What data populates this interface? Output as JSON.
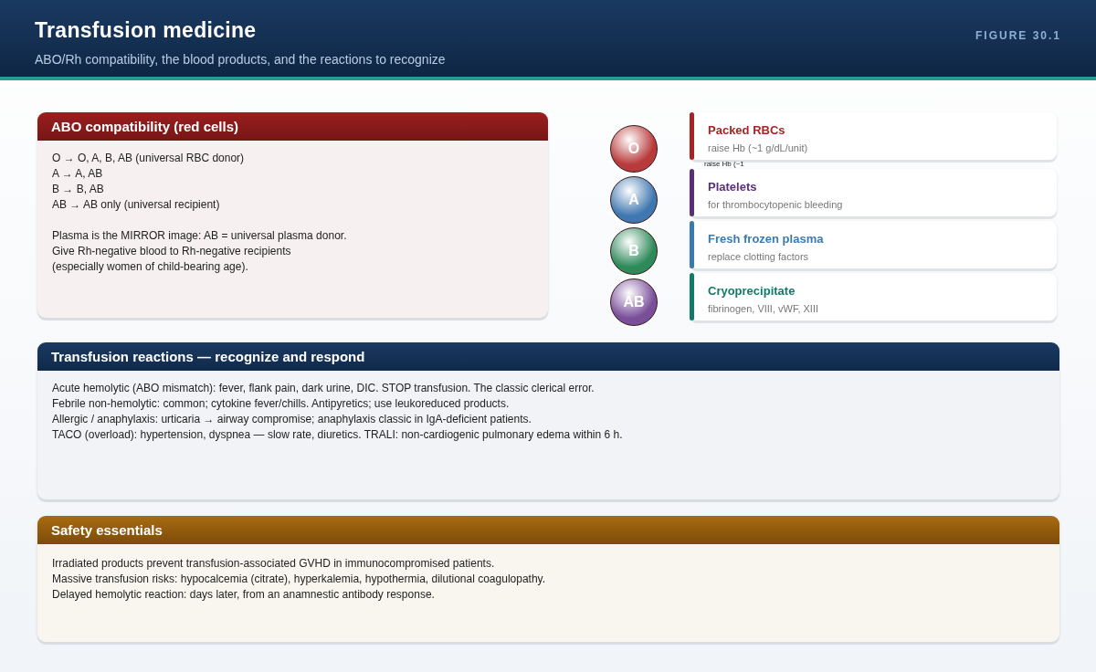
{
  "header": {
    "title": "Transfusion medicine",
    "subtitle": "ABO/Rh compatibility, the blood products, and the reactions to recognize",
    "figure_label": "FIGURE 30.1"
  },
  "abo_card": {
    "title": "ABO compatibility (red cells)",
    "lines": [
      "O → O, A, B, AB (universal RBC donor)",
      "A → A, AB",
      "B → B, AB",
      "AB → AB only (universal recipient)"
    ],
    "notes": [
      "Plasma is the MIRROR image: AB = universal plasma donor.",
      "Give Rh-negative blood to Rh-negative recipients",
      "(especially women of child-bearing age)."
    ]
  },
  "blood_groups": [
    {
      "label": "O",
      "color": "#b83a3a"
    },
    {
      "label": "A",
      "color": "#3f78b0"
    },
    {
      "label": "B",
      "color": "#2f8a5a"
    },
    {
      "label": "AB",
      "color": "#7a4f9a"
    }
  ],
  "products": [
    {
      "name": "Packed RBCs",
      "detail": "raise Hb (~1 g/dL/unit)",
      "color": "#a82323"
    },
    {
      "name": "Platelets",
      "detail": "for thrombocytopenic bleeding",
      "color": "#5a2f7a"
    },
    {
      "name": "Fresh frozen plasma",
      "detail": "replace clotting factors",
      "color": "#3a7ab0"
    },
    {
      "name": "Cryoprecipitate",
      "detail": "fibrinogen, VIII, vWF, XIII",
      "color": "#137a68"
    }
  ],
  "overlap_text": "raise Hb (~1",
  "reactions_card": {
    "title": "Transfusion reactions — recognize and respond",
    "lines": [
      "Acute hemolytic (ABO mismatch): fever, flank pain, dark urine, DIC. STOP transfusion. The classic clerical error.",
      "Febrile non-hemolytic: common; cytokine fever/chills. Antipyretics; use leukoreduced products.",
      "Allergic / anaphylaxis: urticaria → airway compromise; anaphylaxis classic in IgA-deficient patients.",
      "TACO (overload): hypertension, dyspnea — slow rate, diuretics. TRALI: non-cardiogenic pulmonary edema within 6 h."
    ]
  },
  "safety_card": {
    "title": "Safety essentials",
    "lines": [
      "Irradiated products prevent transfusion-associated GVHD in immunocompromised patients.",
      "Massive transfusion risks: hypocalcemia (citrate), hyperkalemia, hypothermia, dilutional coagulopathy.",
      "Delayed hemolytic reaction: days later, from an anamnestic antibody response."
    ]
  }
}
